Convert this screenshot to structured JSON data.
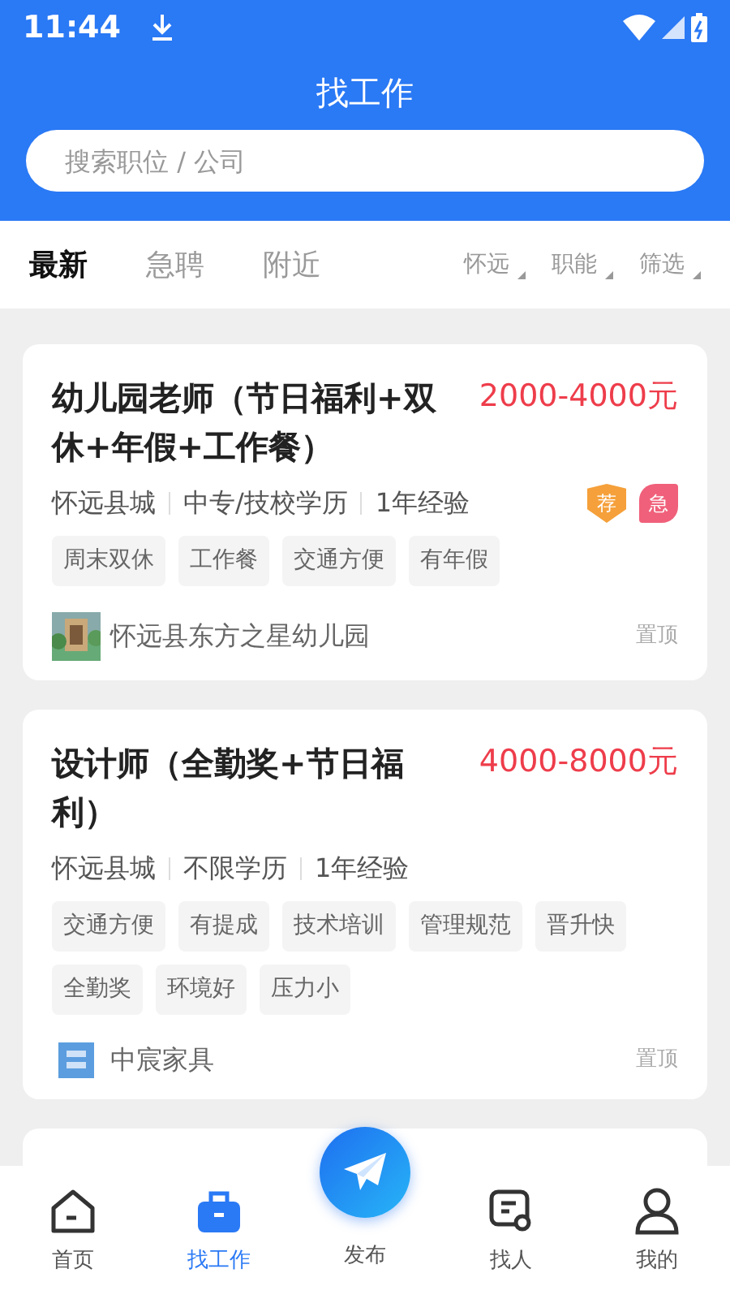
{
  "status_bar": {
    "time": "11:44"
  },
  "header": {
    "title": "找工作"
  },
  "search": {
    "placeholder": "搜索职位 / 公司"
  },
  "tabs": [
    {
      "label": "最新",
      "selected": true
    },
    {
      "label": "急聘",
      "selected": false
    },
    {
      "label": "附近",
      "selected": false
    }
  ],
  "filters": [
    {
      "label": "怀远"
    },
    {
      "label": "职能"
    },
    {
      "label": "筛选"
    }
  ],
  "jobs": [
    {
      "title": "幼儿园老师（节日福利+双休+年假+工作餐）",
      "salary": "2000-4000元",
      "meta": [
        "怀远县城",
        "中专/技校学历",
        "1年经验"
      ],
      "badges": [
        {
          "label": "荐",
          "kind": "shield",
          "color": "#f5a03a"
        },
        {
          "label": "急",
          "kind": "leaf",
          "color": "#f0607a"
        }
      ],
      "tags": [
        "周末双休",
        "工作餐",
        "交通方便",
        "有年假"
      ],
      "company": {
        "name": "怀远县东方之星幼儿园",
        "kind": "picture"
      },
      "pin": "置顶"
    },
    {
      "title": "设计师（全勤奖+节日福利）",
      "salary": "4000-8000元",
      "meta": [
        "怀远县城",
        "不限学历",
        "1年经验"
      ],
      "tags": [
        "交通方便",
        "有提成",
        "技术培训",
        "管理规范",
        "晋升快",
        "全勤奖",
        "环境好",
        "压力小"
      ],
      "company": {
        "name": "中宸家具",
        "kind": "logo"
      },
      "pin": "置顶"
    }
  ],
  "nav": [
    {
      "label": "首页",
      "selected": false
    },
    {
      "label": "找工作",
      "selected": true
    },
    {
      "label": "发布",
      "selected": false
    },
    {
      "label": "找人",
      "selected": false
    },
    {
      "label": "我的",
      "selected": false
    }
  ]
}
